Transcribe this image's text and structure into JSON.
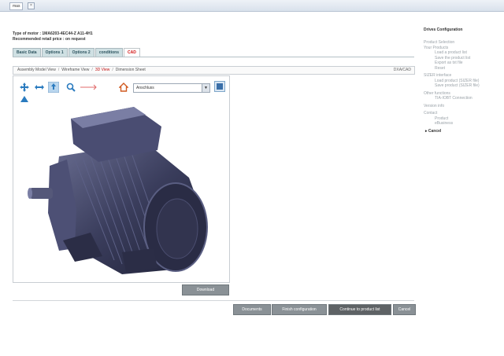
{
  "window": {
    "tab_title": "mas",
    "tab_close": "×"
  },
  "header": {
    "motor_type": "Type of motor : 1MA6203-4EC44-Z A11-4H1",
    "price": "Recommended retail price : on request"
  },
  "tabs": [
    {
      "label": "Basic Data",
      "active": false
    },
    {
      "label": "Options 1",
      "active": false
    },
    {
      "label": "Options 2",
      "active": false
    },
    {
      "label": "conditions",
      "active": false
    },
    {
      "label": "CAD",
      "active": true
    }
  ],
  "views": {
    "links": [
      "Assembly Model View",
      "Wireframe View",
      "3D View",
      "Dimension Sheet"
    ],
    "active_index": 2,
    "right_label": "DXA/CAD"
  },
  "viewer": {
    "select_value": "Anschluss",
    "select_arrow": "▼"
  },
  "buttons": {
    "download": "Download",
    "documents": "Documents",
    "finish": "Finish configuration",
    "continue": "Continue to product list",
    "cancel": "Cancel"
  },
  "sidebar": {
    "title": "Drives Configuration",
    "items": [
      {
        "label": "Product Selection",
        "level": 0
      },
      {
        "label": "Your Products",
        "level": 0
      },
      {
        "label": "Load a product list",
        "level": 1
      },
      {
        "label": "Save the product list",
        "level": 1
      },
      {
        "label": "Export as txt file",
        "level": 1
      },
      {
        "label": "Reset",
        "level": 1
      },
      {
        "label": "",
        "level": "gap"
      },
      {
        "label": "SIZER interface",
        "level": 0
      },
      {
        "label": "Load product (SIZER file)",
        "level": 1
      },
      {
        "label": "Save product (SIZER file)",
        "level": 1
      },
      {
        "label": "",
        "level": "gap"
      },
      {
        "label": "Other functions",
        "level": 0
      },
      {
        "label": "TIA-IOBT Connection",
        "level": 1
      },
      {
        "label": "",
        "level": "gap"
      },
      {
        "label": "Version info",
        "level": 0
      },
      {
        "label": "",
        "level": "gap"
      },
      {
        "label": "Contact",
        "level": 0
      },
      {
        "label": "Product",
        "level": 1
      },
      {
        "label": "eBusiness",
        "level": 1
      }
    ],
    "cancel": "▸ Cancel"
  },
  "colors": {
    "accent_red": "#d01010",
    "tab_bg": "#cfe0e3",
    "button_gray": "#8a9196",
    "motor": "#3b3d5c"
  },
  "icons": [
    "move-arrows-icon",
    "rotate-icon",
    "fit-view-icon",
    "zoom-icon",
    "measure-icon",
    "home-icon",
    "settings-icon",
    "axis-icon"
  ]
}
